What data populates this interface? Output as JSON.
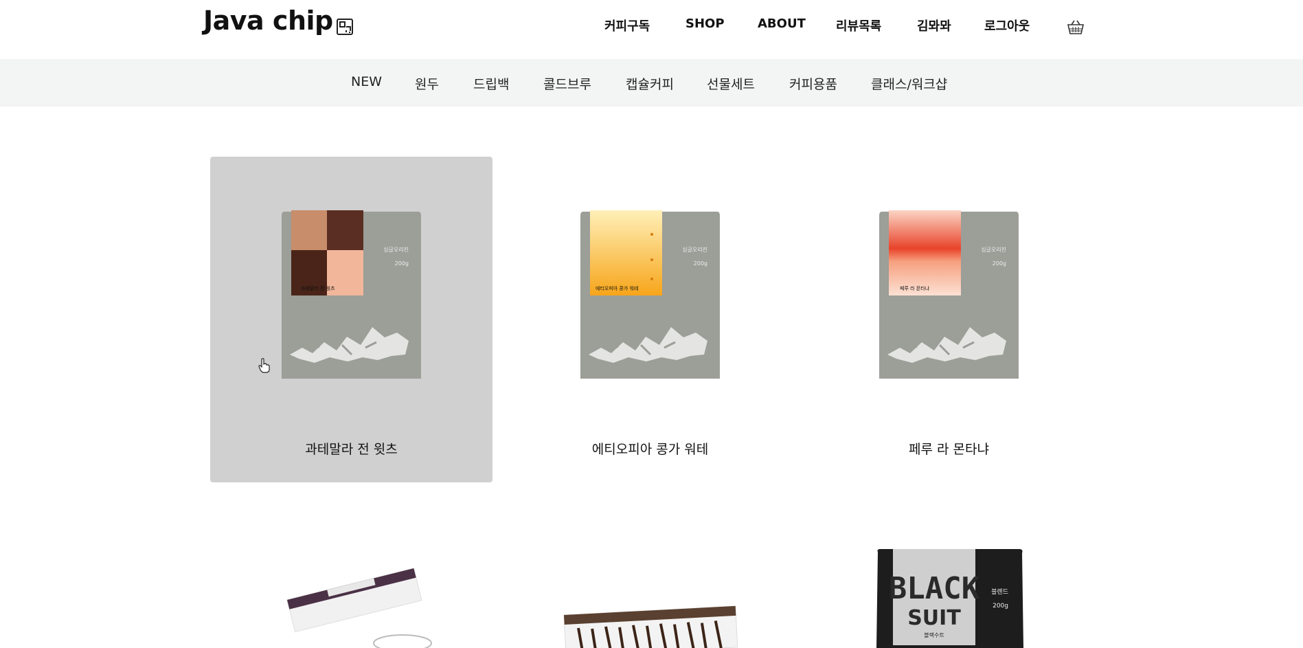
{
  "header": {
    "logo": "Java chip",
    "nav": [
      "커피구독",
      "SHOP",
      "ABOUT",
      "리뷰목록",
      "김뫄뫄",
      "로그아웃"
    ]
  },
  "categories": [
    "NEW",
    "원두",
    "드립백",
    "콜드브루",
    "캡슐커피",
    "선물세트",
    "커피용품",
    "클래스/워크샵"
  ],
  "products": [
    {
      "name": "과테말라 전 윗츠",
      "label_text": "과테말라 전 윗츠",
      "origin": "싱글오리진",
      "weight": "200g"
    },
    {
      "name": "에티오피아 콩가 워테",
      "label_text": "에티오피아 콩가 워테",
      "origin": "싱글오리진",
      "weight": "200g"
    },
    {
      "name": "페루 라 몬타냐",
      "label_text": "페루 라 몬타냐",
      "origin": "싱글오리진",
      "weight": "200g"
    }
  ],
  "second_row": {
    "black_suit": {
      "logo_top": "BLACK",
      "logo_bottom": "SUIT",
      "type": "블렌드",
      "weight": "200g",
      "caption": "블랙수트"
    }
  },
  "colors": {
    "hover_card": "#d0d0d1",
    "category_bar": "#f3f4f4",
    "bag_gray": "#9c9e98"
  }
}
